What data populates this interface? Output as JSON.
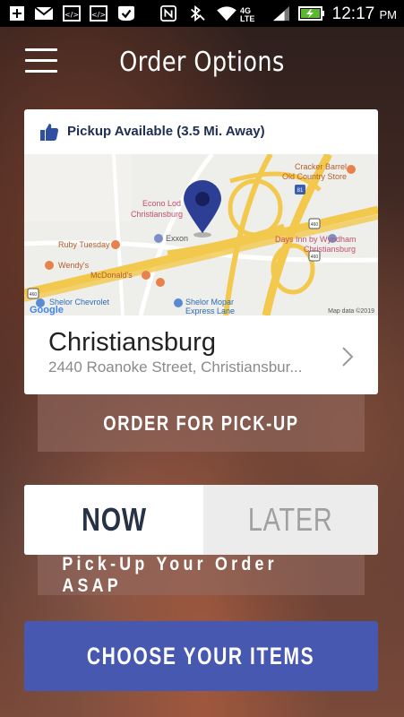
{
  "status_bar": {
    "time": "12:17",
    "ampm": "PM",
    "network": "4G LTE",
    "icons": [
      "add-icon",
      "gmail-icon",
      "code-icon",
      "code-icon",
      "check-shield-icon",
      "nfc-icon",
      "bluetooth-mute-icon",
      "wifi-icon",
      "signal-icon",
      "battery-charging-icon"
    ]
  },
  "header": {
    "title": "Order Options"
  },
  "location_card": {
    "pickup_text": "Pickup Available (3.5 Mi. Away)",
    "store_name": "Christiansburg",
    "store_address": "2440 Roanoke Street, Christiansbur...",
    "map": {
      "labels": {
        "cracker_barrel": "Cracker Barrel",
        "cracker_barrel_2": "Old Country Store",
        "econo": "Econo Lod",
        "econo_2": "Christiansburg",
        "ruby": "Ruby Tuesday",
        "exxon": "Exxon",
        "days_inn": "Days Inn by Wyndham",
        "days_inn_2": "Christiansburg",
        "wendys": "Wendy's",
        "mcdonalds": "McDonald's",
        "shelor_chev": "Shelor Chevrolet",
        "shelor_mopar": "Shelor Mopar",
        "shelor_mopar_2": "Express Lane",
        "google": "Google",
        "map_data": "Map data ©2019",
        "shield_81": "81",
        "shield_460a": "460",
        "shield_460b": "460",
        "shield_460c": "460"
      }
    }
  },
  "order_button": {
    "label": "ORDER FOR PICK-UP"
  },
  "timing_toggle": {
    "now_label": "NOW",
    "later_label": "LATER",
    "selected": "NOW"
  },
  "asap_text": "Pick-Up Your Order ASAP",
  "choose_button": {
    "label": "CHOOSE YOUR ITEMS"
  },
  "colors": {
    "accent": "#4758b0",
    "navy": "#1e2d52",
    "highway": "#f2c94c"
  }
}
